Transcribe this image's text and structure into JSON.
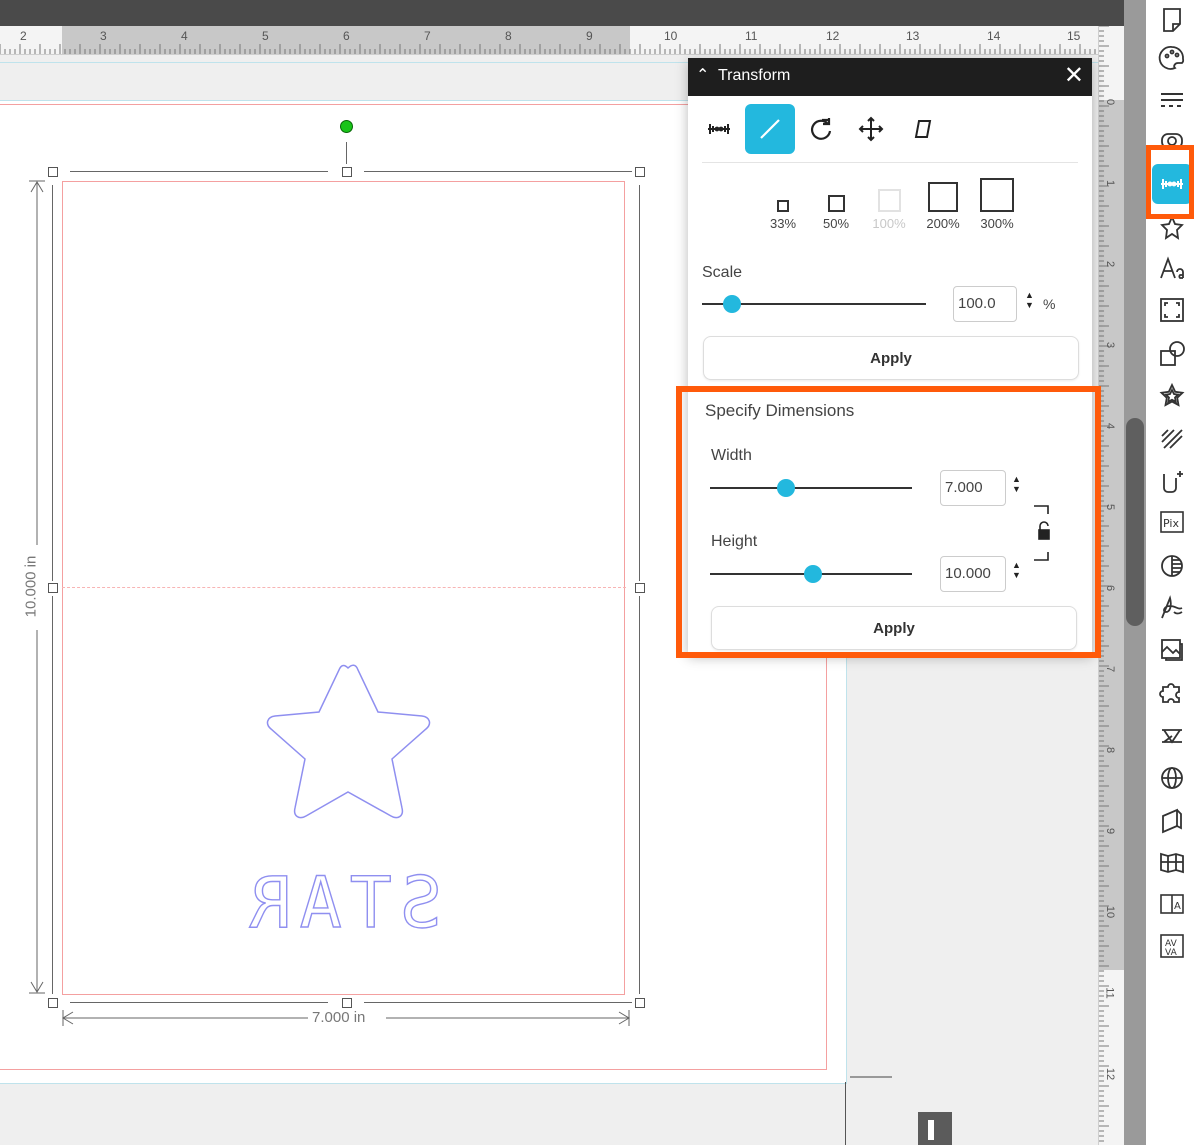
{
  "ruler_top": {
    "labels": [
      "2",
      "3",
      "4",
      "5",
      "6",
      "7",
      "8",
      "9",
      "10",
      "11",
      "12",
      "13",
      "14",
      "15"
    ]
  },
  "ruler_right": {
    "labels": [
      "0",
      "1",
      "2",
      "3",
      "4",
      "5",
      "6",
      "7",
      "8",
      "9",
      "10",
      "11",
      "12"
    ]
  },
  "design": {
    "text": "STAR",
    "height_label": "10.000 in",
    "width_label": "7.000 in"
  },
  "transform_panel": {
    "title": "Transform",
    "tabs": [
      "scale-icon",
      "stretch-icon",
      "rotate-icon",
      "move-icon",
      "shear-icon"
    ],
    "presets": [
      {
        "label": "33%",
        "enabled": true
      },
      {
        "label": "50%",
        "enabled": true
      },
      {
        "label": "100%",
        "enabled": false
      },
      {
        "label": "200%",
        "enabled": true
      },
      {
        "label": "300%",
        "enabled": true
      }
    ],
    "scale": {
      "label": "Scale",
      "value": "100.0",
      "unit": "%",
      "apply_label": "Apply"
    },
    "dimensions": {
      "title": "Specify Dimensions",
      "width_label": "Width",
      "width_value": "7.000",
      "height_label": "Height",
      "height_value": "10.000",
      "apply_label": "Apply",
      "lock_state": "unlocked"
    }
  },
  "toolbar": {
    "items": [
      "page-setup-icon",
      "design-icon",
      "lines-icon",
      "offset-icon",
      "transform-icon",
      "trace-icon",
      "text-icon",
      "crop-icon",
      "shapes-icon",
      "star-icon",
      "sketch-icon",
      "puzzle-marker-icon",
      "pix-icon",
      "contrast-icon",
      "signature-icon",
      "image-icon",
      "puzzle-icon",
      "replicate-icon",
      "globe-icon",
      "fold-icon",
      "map-icon",
      "text-layout-icon",
      "text-style-icon"
    ],
    "active": "transform-icon"
  },
  "colors": {
    "accent": "#23b8de",
    "highlight": "#ff5a0a",
    "cut_line": "#f4a0a0",
    "design_stroke": "#8f8ff0"
  }
}
